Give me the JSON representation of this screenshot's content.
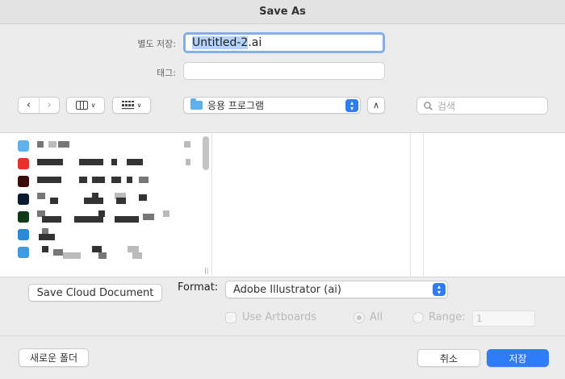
{
  "window": {
    "title": "Save As"
  },
  "save_form": {
    "name_label": "별도 저장:",
    "file_name_selected": "Untitled-2",
    "file_name_extension": ".ai",
    "tags_label": "태그:",
    "tags_value": ""
  },
  "toolbar": {
    "back_icon": "chevron-left-icon",
    "forward_icon": "chevron-right-icon",
    "view_columns_icon": "columns-view-icon",
    "view_grid_icon": "grid-view-icon",
    "location": "응용 프로그램",
    "up_icon": "chevron-up-icon",
    "search_placeholder": "검색"
  },
  "options": {
    "cloud_button": "Save Cloud Document",
    "format_label": "Format:",
    "format_value": "Adobe Illustrator (ai)",
    "use_artboards_label": "Use Artboards",
    "all_label": "All",
    "range_label": "Range:",
    "range_value": "1"
  },
  "footer": {
    "new_folder": "새로운 폴더",
    "cancel": "취소",
    "save": "저장"
  },
  "colors": {
    "accent": "#2f7cf6",
    "focus_ring": "#84aeea",
    "selection": "#b3d3fb"
  }
}
